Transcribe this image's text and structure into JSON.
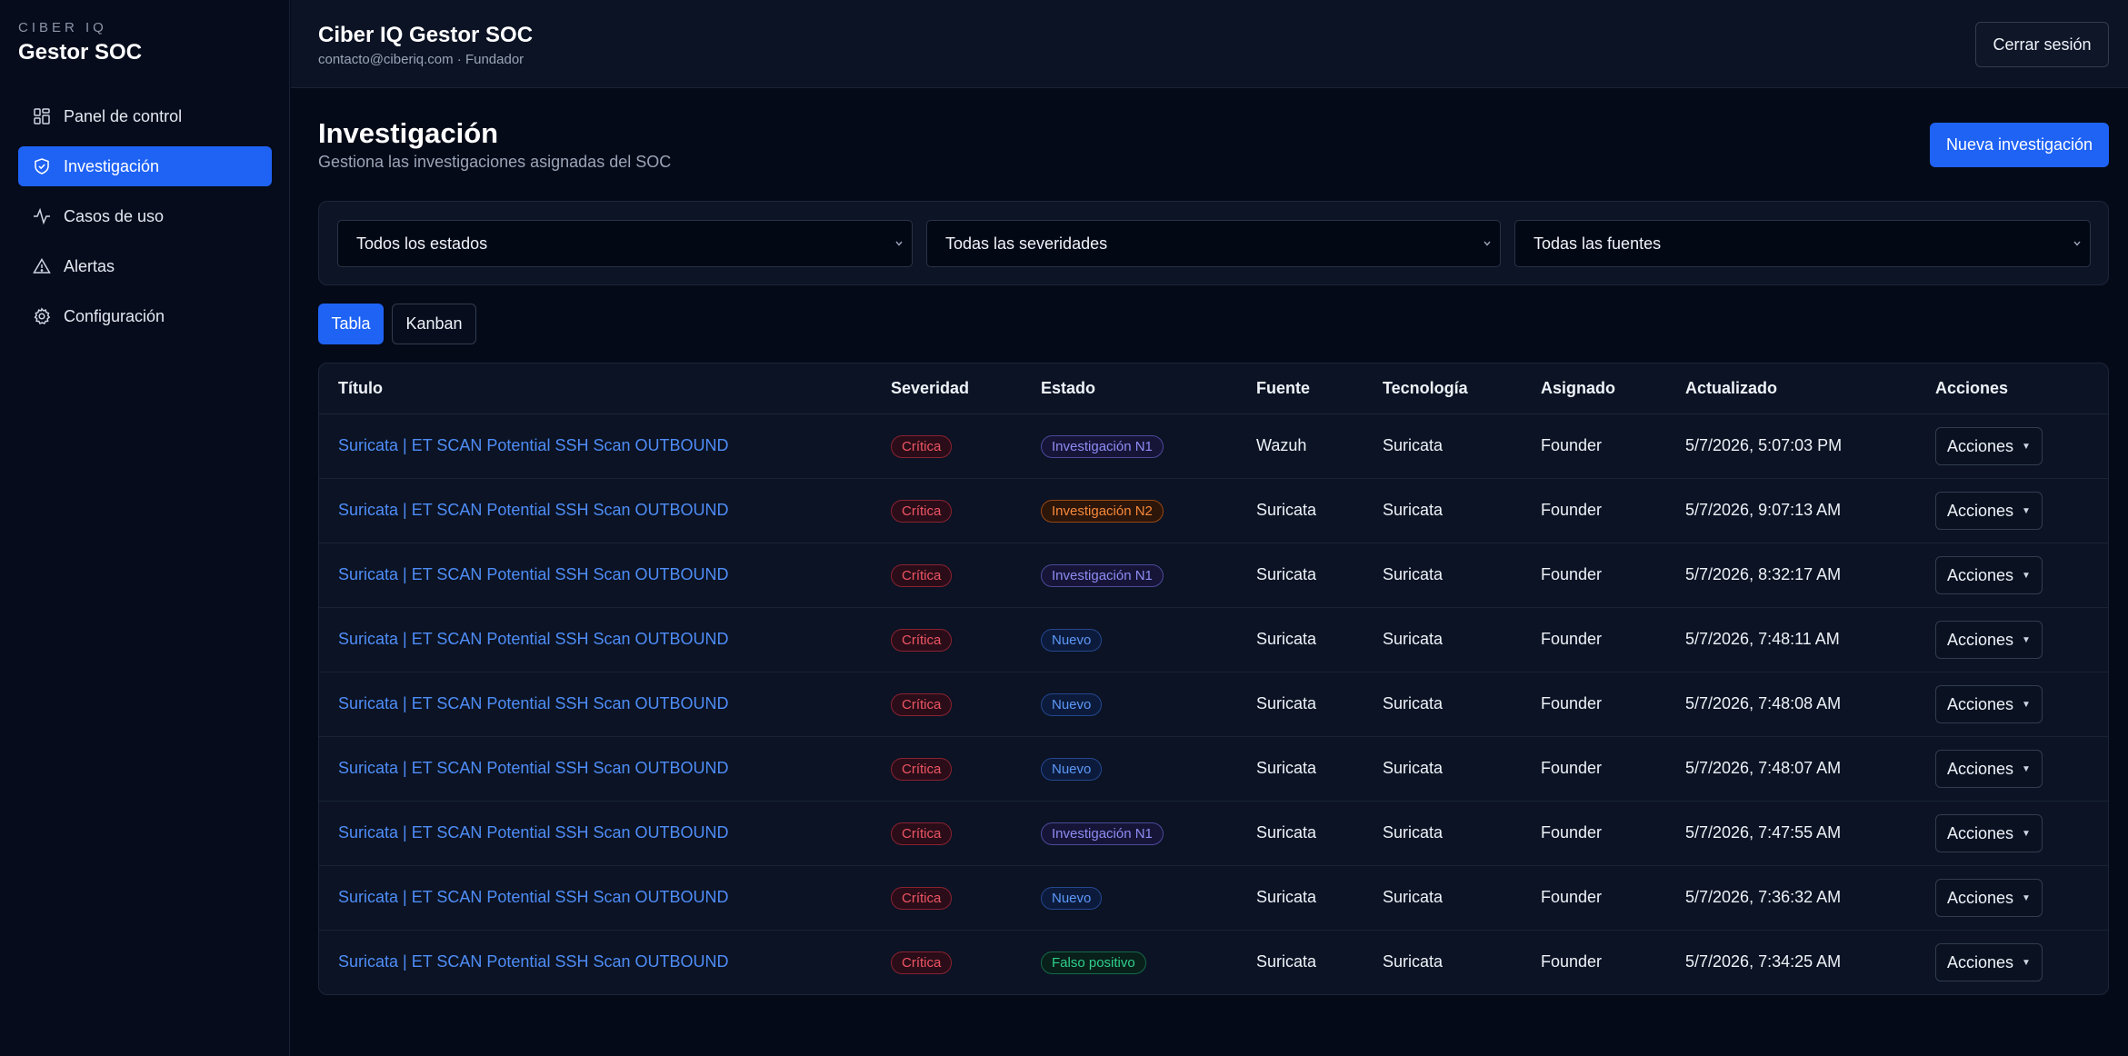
{
  "sidebar": {
    "brand_small": "CIBER IQ",
    "brand_title": "Gestor SOC",
    "items": [
      {
        "label": "Panel de control",
        "icon": "dashboard-icon"
      },
      {
        "label": "Investigación",
        "icon": "shield-icon",
        "active": true
      },
      {
        "label": "Casos de uso",
        "icon": "activity-icon"
      },
      {
        "label": "Alertas",
        "icon": "warning-icon"
      },
      {
        "label": "Configuración",
        "icon": "gear-icon"
      }
    ]
  },
  "header": {
    "title": "Ciber IQ Gestor SOC",
    "subtitle": "contacto@ciberiq.com · Fundador",
    "logout_label": "Cerrar sesión"
  },
  "page": {
    "title": "Investigación",
    "subtitle": "Gestiona las investigaciones asignadas del SOC",
    "new_button": "Nueva investigación"
  },
  "filters": {
    "status": "Todos los estados",
    "severity": "Todas las severidades",
    "source": "Todas las fuentes"
  },
  "view_tabs": {
    "table": "Tabla",
    "kanban": "Kanban",
    "active": "Tabla"
  },
  "table": {
    "columns": [
      "Título",
      "Severidad",
      "Estado",
      "Fuente",
      "Tecnología",
      "Asignado",
      "Actualizado",
      "Acciones"
    ],
    "actions_label": "Acciones",
    "rows": [
      {
        "title": "Suricata | ET SCAN Potential SSH Scan OUTBOUND",
        "severity": "Crítica",
        "status": "Investigación N1",
        "source": "Wazuh",
        "technology": "Suricata",
        "assigned": "Founder",
        "updated": "5/7/2026, 5:07:03 PM"
      },
      {
        "title": "Suricata | ET SCAN Potential SSH Scan OUTBOUND",
        "severity": "Crítica",
        "status": "Investigación N2",
        "source": "Suricata",
        "technology": "Suricata",
        "assigned": "Founder",
        "updated": "5/7/2026, 9:07:13 AM"
      },
      {
        "title": "Suricata | ET SCAN Potential SSH Scan OUTBOUND",
        "severity": "Crítica",
        "status": "Investigación N1",
        "source": "Suricata",
        "technology": "Suricata",
        "assigned": "Founder",
        "updated": "5/7/2026, 8:32:17 AM"
      },
      {
        "title": "Suricata | ET SCAN Potential SSH Scan OUTBOUND",
        "severity": "Crítica",
        "status": "Nuevo",
        "source": "Suricata",
        "technology": "Suricata",
        "assigned": "Founder",
        "updated": "5/7/2026, 7:48:11 AM"
      },
      {
        "title": "Suricata | ET SCAN Potential SSH Scan OUTBOUND",
        "severity": "Crítica",
        "status": "Nuevo",
        "source": "Suricata",
        "technology": "Suricata",
        "assigned": "Founder",
        "updated": "5/7/2026, 7:48:08 AM"
      },
      {
        "title": "Suricata | ET SCAN Potential SSH Scan OUTBOUND",
        "severity": "Crítica",
        "status": "Nuevo",
        "source": "Suricata",
        "technology": "Suricata",
        "assigned": "Founder",
        "updated": "5/7/2026, 7:48:07 AM"
      },
      {
        "title": "Suricata | ET SCAN Potential SSH Scan OUTBOUND",
        "severity": "Crítica",
        "status": "Investigación N1",
        "source": "Suricata",
        "technology": "Suricata",
        "assigned": "Founder",
        "updated": "5/7/2026, 7:47:55 AM"
      },
      {
        "title": "Suricata | ET SCAN Potential SSH Scan OUTBOUND",
        "severity": "Crítica",
        "status": "Nuevo",
        "source": "Suricata",
        "technology": "Suricata",
        "assigned": "Founder",
        "updated": "5/7/2026, 7:36:32 AM"
      },
      {
        "title": "Suricata | ET SCAN Potential SSH Scan OUTBOUND",
        "severity": "Crítica",
        "status": "Falso positivo",
        "source": "Suricata",
        "technology": "Suricata",
        "assigned": "Founder",
        "updated": "5/7/2026, 7:34:25 AM"
      }
    ]
  },
  "colors": {
    "accent": "#1f63f5",
    "background": "#050a18",
    "link": "#4f8df7",
    "critical": "#ee5564",
    "status_n1": "#8e8cf2",
    "status_n2": "#f6893b",
    "status_new": "#5d98f7",
    "status_false_positive": "#2fcf8a"
  }
}
